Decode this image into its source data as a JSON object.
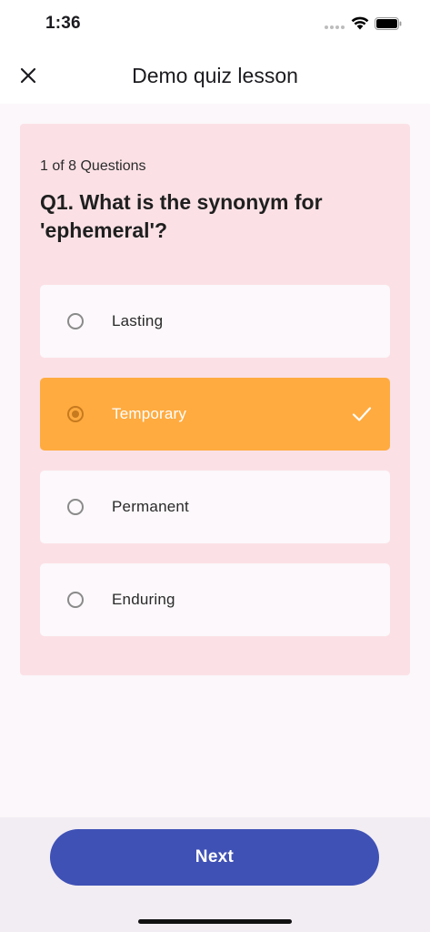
{
  "status_bar": {
    "time": "1:36"
  },
  "header": {
    "title": "Demo quiz lesson",
    "close_icon": "close-icon"
  },
  "quiz": {
    "progress": "1 of 8 Questions",
    "question": "Q1. What is the synonym for 'ephemeral'?",
    "options": [
      {
        "label": "Lasting",
        "selected": false
      },
      {
        "label": "Temporary",
        "selected": true
      },
      {
        "label": "Permanent",
        "selected": false
      },
      {
        "label": "Enduring",
        "selected": false
      }
    ]
  },
  "footer": {
    "next_label": "Next"
  },
  "colors": {
    "card_bg": "#fbe1e6",
    "selected_option": "#ffab40",
    "primary_button": "#3f51b5"
  }
}
